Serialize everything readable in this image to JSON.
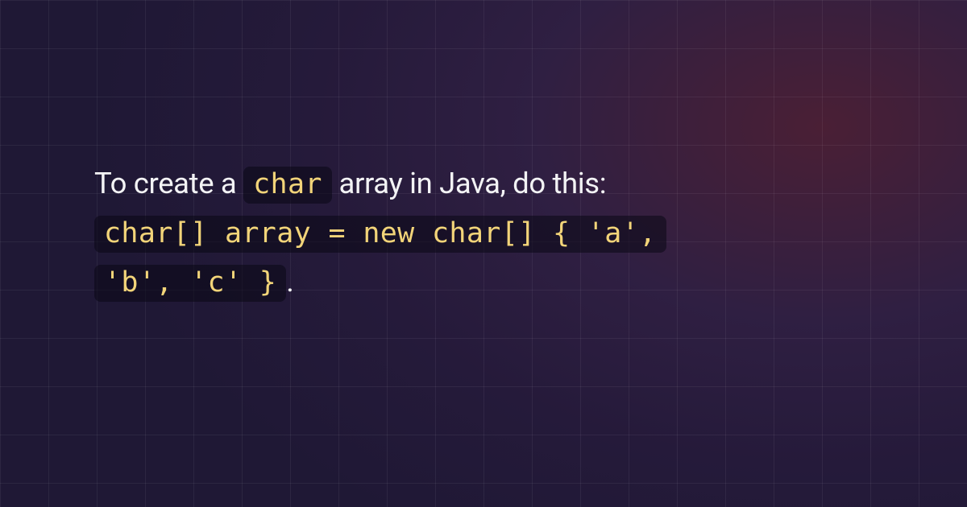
{
  "content": {
    "text1": "To create a ",
    "inline_code": "char",
    "text2": " array in Java, do this: ",
    "code_line1": "char[] array = new char[] { 'a',",
    "code_line2": "'b', 'c' }",
    "text3": "."
  },
  "colors": {
    "code_text": "#f2d479",
    "body_text": "#f5f5f7",
    "code_bg": "rgba(10,8,20,0.55)"
  }
}
